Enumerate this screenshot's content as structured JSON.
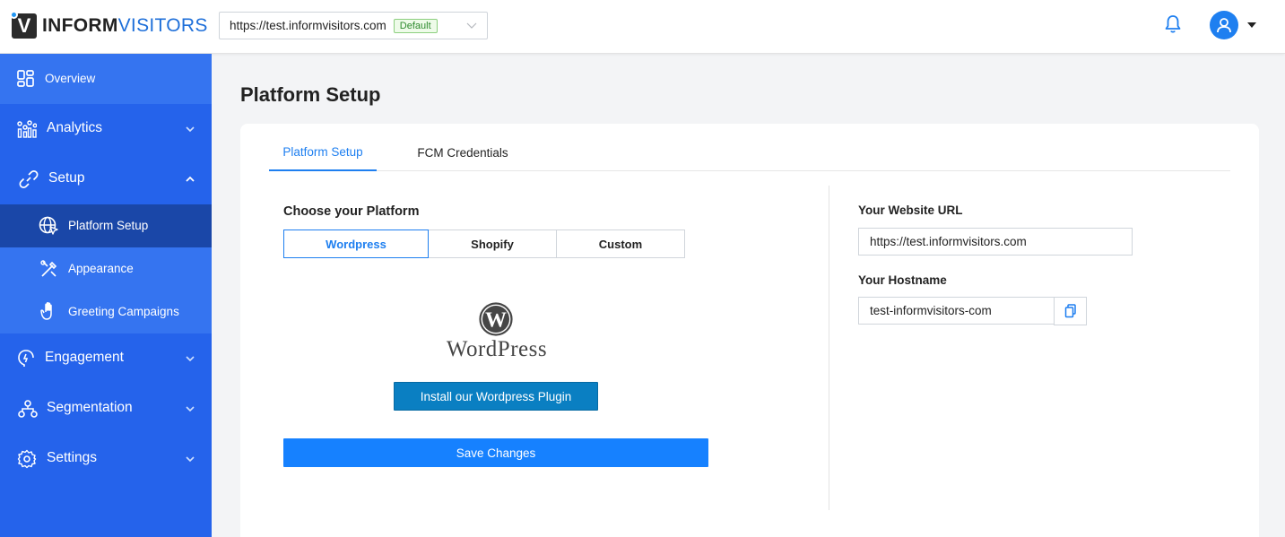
{
  "header": {
    "logo_text_dark": "INFORM",
    "logo_text_accent": "VISITORS",
    "logo_mark": "V",
    "site_url": "https://test.informvisitors.com",
    "site_badge": "Default",
    "icons": [
      "bell-icon",
      "user-icon",
      "caret-down-icon",
      "chevron-down-icon"
    ]
  },
  "sidebar": {
    "items": [
      {
        "label": "Overview",
        "icon": "dashboard-icon"
      },
      {
        "label": "Analytics",
        "icon": "analytics-icon"
      },
      {
        "label": "Setup",
        "icon": "setup-icon"
      },
      {
        "label": "Platform Setup",
        "icon": "globe-cursor-icon"
      },
      {
        "label": "Appearance",
        "icon": "brush-icon"
      },
      {
        "label": "Greeting Campaigns",
        "icon": "hand-icon"
      },
      {
        "label": "Engagement",
        "icon": "engagement-icon"
      },
      {
        "label": "Segmentation",
        "icon": "segmentation-icon"
      },
      {
        "label": "Settings",
        "icon": "gear-icon"
      }
    ]
  },
  "main": {
    "page_title": "Platform Setup",
    "tabs": [
      {
        "label": "Platform Setup"
      },
      {
        "label": "FCM Credentials"
      }
    ],
    "choose_platform_label": "Choose your Platform",
    "platforms": [
      "Wordpress",
      "Shopify",
      "Custom"
    ],
    "selected_platform": "Wordpress",
    "wordpress_logo_text": "WordPress",
    "install_button": "Install our Wordpress Plugin",
    "save_button": "Save Changes",
    "website_url_label": "Your Website URL",
    "website_url_value": "https://test.informvisitors.com",
    "hostname_label": "Your Hostname",
    "hostname_value": "test-informvisitors-com"
  },
  "colors": {
    "sidebar_bg": "#2563eb",
    "sidebar_active": "#1a47a8",
    "primary": "#1681ff",
    "install_button": "#0a7fc2"
  }
}
